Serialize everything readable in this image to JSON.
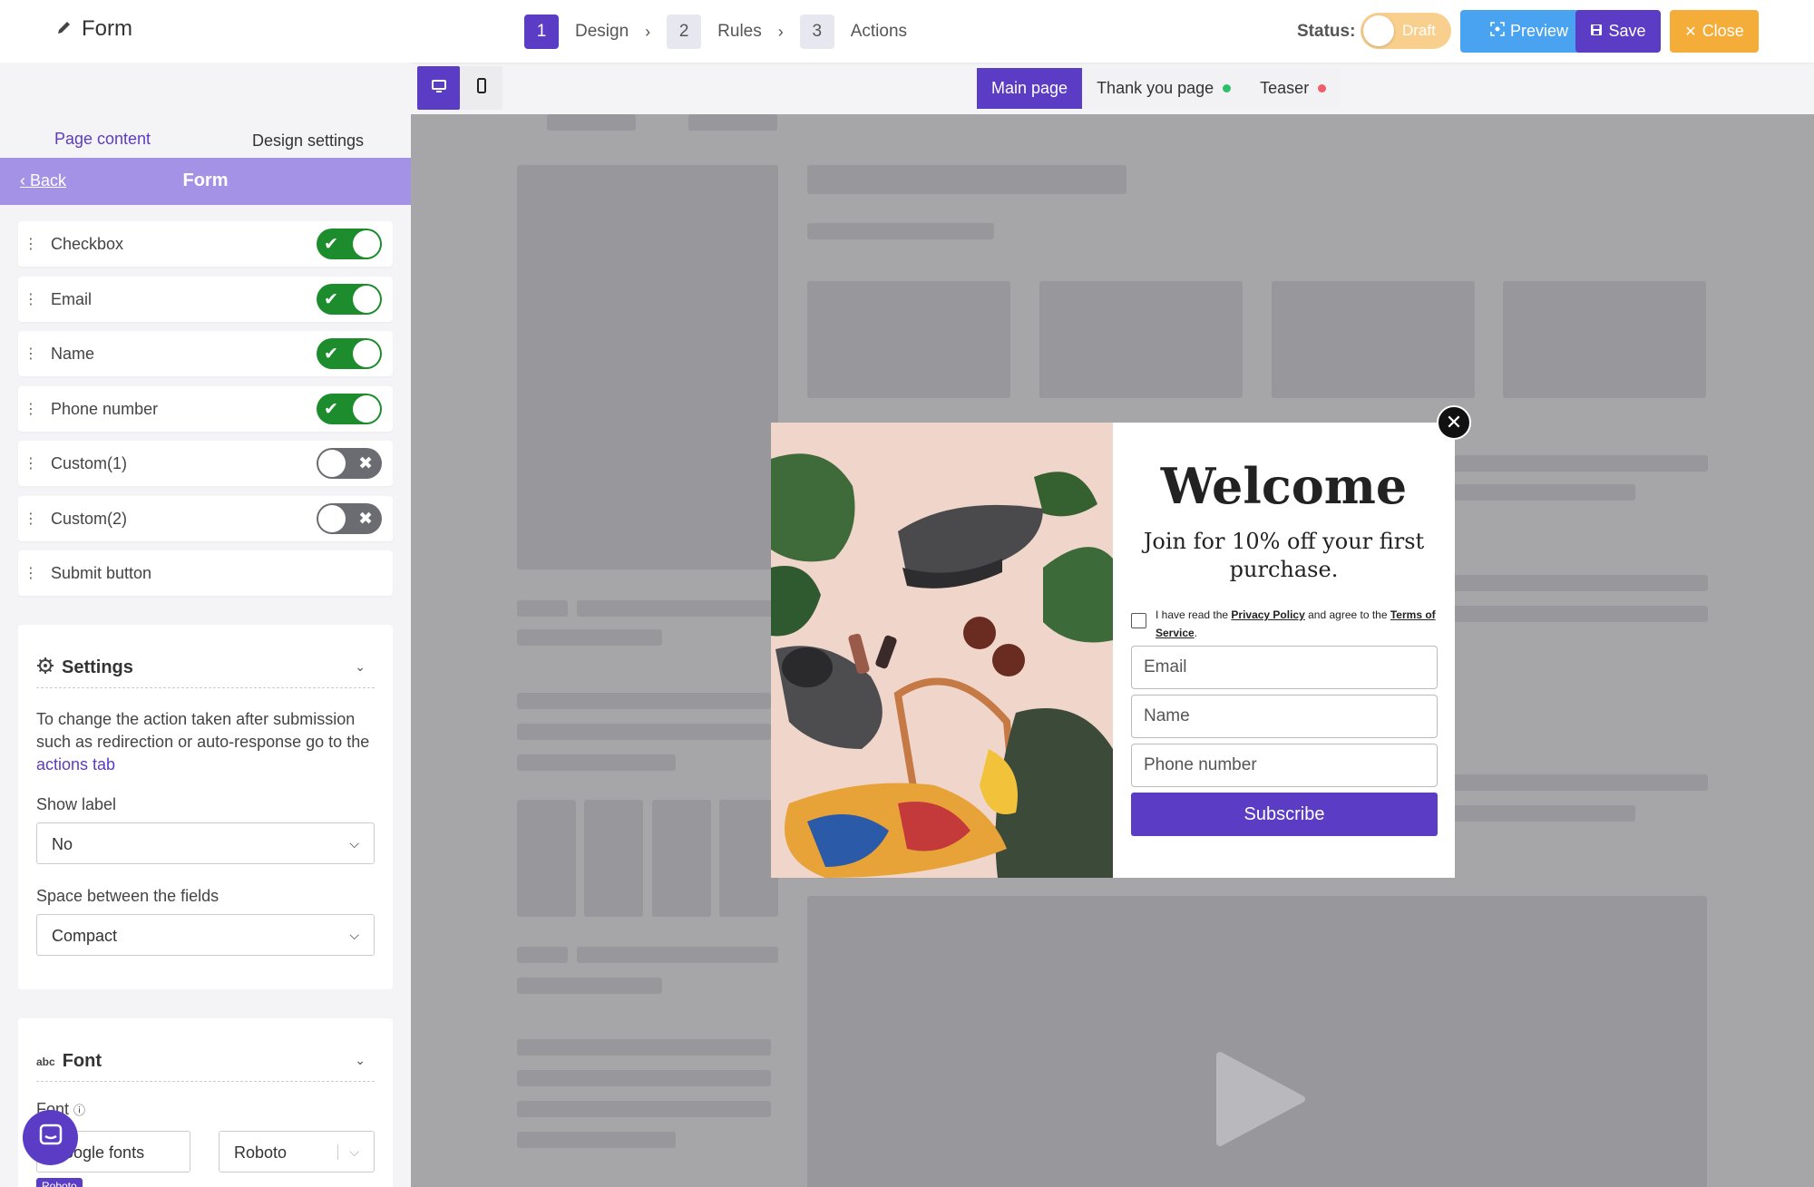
{
  "header": {
    "form_label": "Form",
    "steps": [
      {
        "num": "1",
        "label": "Design"
      },
      {
        "num": "2",
        "label": "Rules"
      },
      {
        "num": "3",
        "label": "Actions"
      }
    ],
    "status_label": "Status:",
    "status_value": "Draft",
    "preview": "Preview",
    "save": "Save",
    "close": "Close"
  },
  "device_tabs": {
    "desktop_icon": "desktop-icon",
    "mobile_icon": "mobile-icon"
  },
  "page_tabs": [
    {
      "label": "Main page",
      "dot": ""
    },
    {
      "label": "Thank you page",
      "dot": "#2dbf6a"
    },
    {
      "label": "Teaser",
      "dot": "#ef5d6a"
    }
  ],
  "sidebar": {
    "tabs": [
      "Page content",
      "Design settings"
    ],
    "back": "Back",
    "title": "Form",
    "fields": [
      {
        "label": "Checkbox",
        "on": true
      },
      {
        "label": "Email",
        "on": true
      },
      {
        "label": "Name",
        "on": true
      },
      {
        "label": "Phone number",
        "on": true
      },
      {
        "label": "Custom(1)",
        "on": false
      },
      {
        "label": "Custom(2)",
        "on": false
      },
      {
        "label": "Submit button"
      }
    ],
    "settings": {
      "title": "Settings",
      "text_before": "To change the action taken after submission such as redirection or auto-response go to the ",
      "link": "actions tab",
      "show_label": "Show label",
      "show_label_value": "No",
      "space_label": "Space between the fields",
      "space_value": "Compact"
    },
    "font": {
      "title": "Font",
      "font_label": "Font",
      "source_value": "Google fonts",
      "family_value": "Roboto",
      "badge": "Roboto"
    }
  },
  "popup": {
    "heading": "Welcome",
    "subheading": "Join for 10% off your first purchase.",
    "consent_prefix": "I have read the ",
    "privacy": "Privacy Policy",
    "consent_mid": " and agree to the ",
    "terms": "Terms of Service",
    "consent_suffix": ".",
    "email_ph": "Email",
    "name_ph": "Name",
    "phone_ph": "Phone number",
    "subscribe": "Subscribe"
  },
  "colors": {
    "accent": "#5b3cc4",
    "success": "#1c8c2c",
    "preview": "#4aa3f0",
    "close": "#f5ad3a"
  }
}
